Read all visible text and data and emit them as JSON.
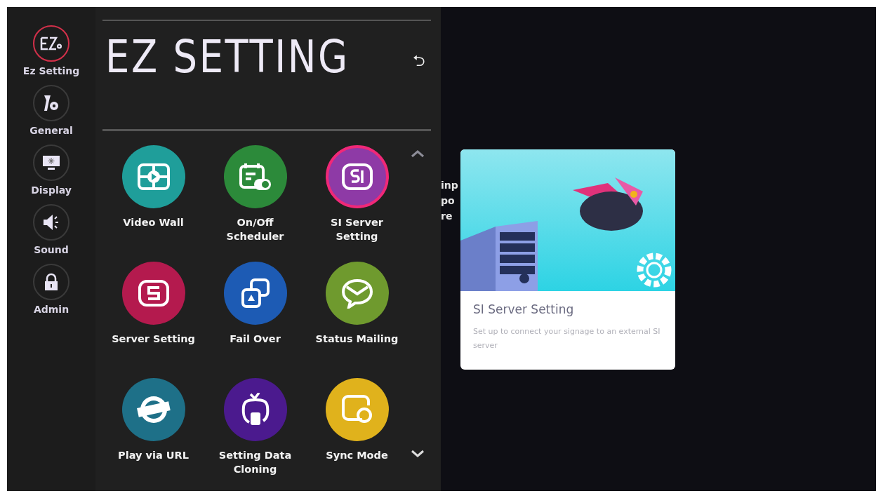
{
  "sidebar": {
    "items": [
      {
        "label": "Ez Setting",
        "selected": true
      },
      {
        "label": "General",
        "selected": false
      },
      {
        "label": "Display",
        "selected": false
      },
      {
        "label": "Sound",
        "selected": false
      },
      {
        "label": "Admin",
        "selected": false
      }
    ]
  },
  "panel": {
    "title": "EZ SETTING",
    "back": "⮌",
    "items": [
      {
        "label": "Video Wall",
        "color": "#1f9e9a",
        "selected": false
      },
      {
        "label": "On/Off Scheduler",
        "color": "#2c8a3a",
        "selected": false
      },
      {
        "label": "SI Server Setting",
        "color": "#8e3aa6",
        "selected": true
      },
      {
        "label": "Server Setting",
        "color": "#b41a4e",
        "selected": false
      },
      {
        "label": "Fail Over",
        "color": "#1d5bb4",
        "selected": false
      },
      {
        "label": "Status Mailing",
        "color": "#6f9a2e",
        "selected": false
      },
      {
        "label": "Play via URL",
        "color": "#1e7088",
        "selected": false
      },
      {
        "label": "Setting Data Cloning",
        "color": "#4b1a8e",
        "selected": false
      },
      {
        "label": "Sync Mode",
        "color": "#e0b21c",
        "selected": false
      }
    ]
  },
  "background_message": [
    "inp",
    "po",
    "re"
  ],
  "info_card": {
    "title": "SI Server Setting",
    "description": "Set up to connect your signage to an external SI server"
  }
}
